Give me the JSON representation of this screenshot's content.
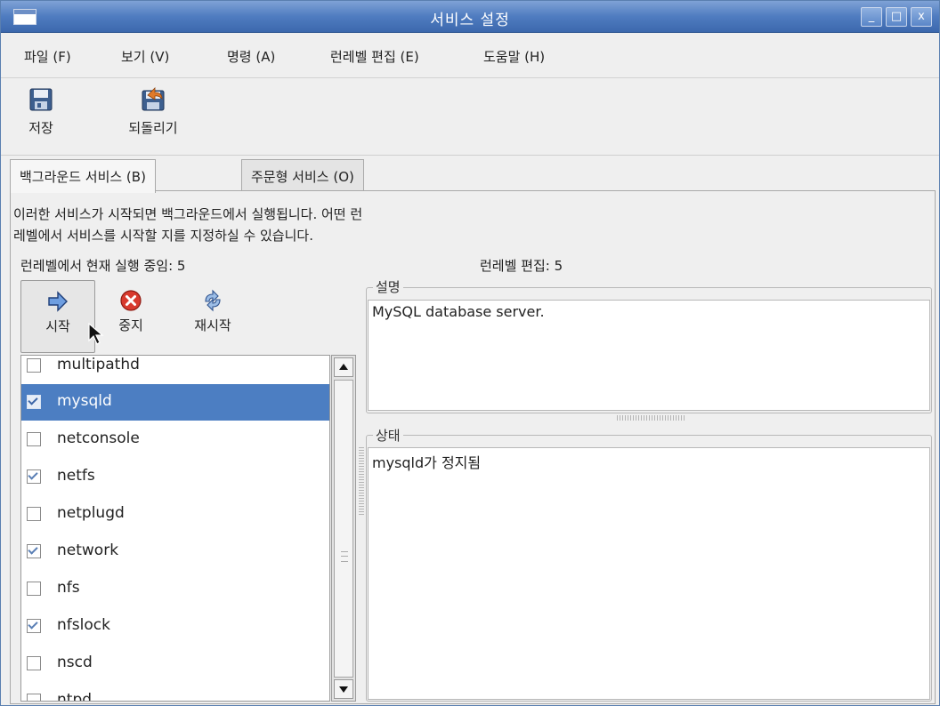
{
  "window": {
    "title": "서비스 설정",
    "minimize_glyph": "_",
    "maximize_glyph": "□",
    "close_glyph": "x"
  },
  "menu": [
    "파일 (F)",
    "보기 (V)",
    "명령 (A)",
    "런레벨 편집 (E)",
    "도움말 (H)"
  ],
  "toolbar": {
    "save_label": "저장",
    "revert_label": "되돌리기"
  },
  "tabs": {
    "background": "백그라운드 서비스 (B)",
    "on_demand": "주문형 서비스 (O)"
  },
  "description": {
    "line1": "이러한 서비스가 시작되면 백그라운드에서 실행됩니다. 어떤 런",
    "line2": "레벨에서 서비스를 시작할 지를 지정하실 수 있습니다."
  },
  "runlevel": {
    "current": "런레벨에서 현재 실행 중임: 5",
    "editing": "런레벨 편집: 5"
  },
  "actions": {
    "start": "시작",
    "stop": "중지",
    "restart": "재시작"
  },
  "services": [
    {
      "name": "multipathd",
      "checked": false,
      "selected": false
    },
    {
      "name": "mysqld",
      "checked": true,
      "selected": true
    },
    {
      "name": "netconsole",
      "checked": false,
      "selected": false
    },
    {
      "name": "netfs",
      "checked": true,
      "selected": false
    },
    {
      "name": "netplugd",
      "checked": false,
      "selected": false
    },
    {
      "name": "network",
      "checked": true,
      "selected": false
    },
    {
      "name": "nfs",
      "checked": false,
      "selected": false
    },
    {
      "name": "nfslock",
      "checked": true,
      "selected": false
    },
    {
      "name": "nscd",
      "checked": false,
      "selected": false
    },
    {
      "name": "ntpd",
      "checked": false,
      "selected": false
    }
  ],
  "details": {
    "description_label": "설명",
    "description_text": "MySQL database server.",
    "status_label": "상태",
    "status_text": "mysqld가 정지됨"
  },
  "colors": {
    "titlebar": "#4f7cc0",
    "selection": "#4c7ec2",
    "stop_red": "#d83a2e",
    "start_blue": "#3a6fc2"
  }
}
